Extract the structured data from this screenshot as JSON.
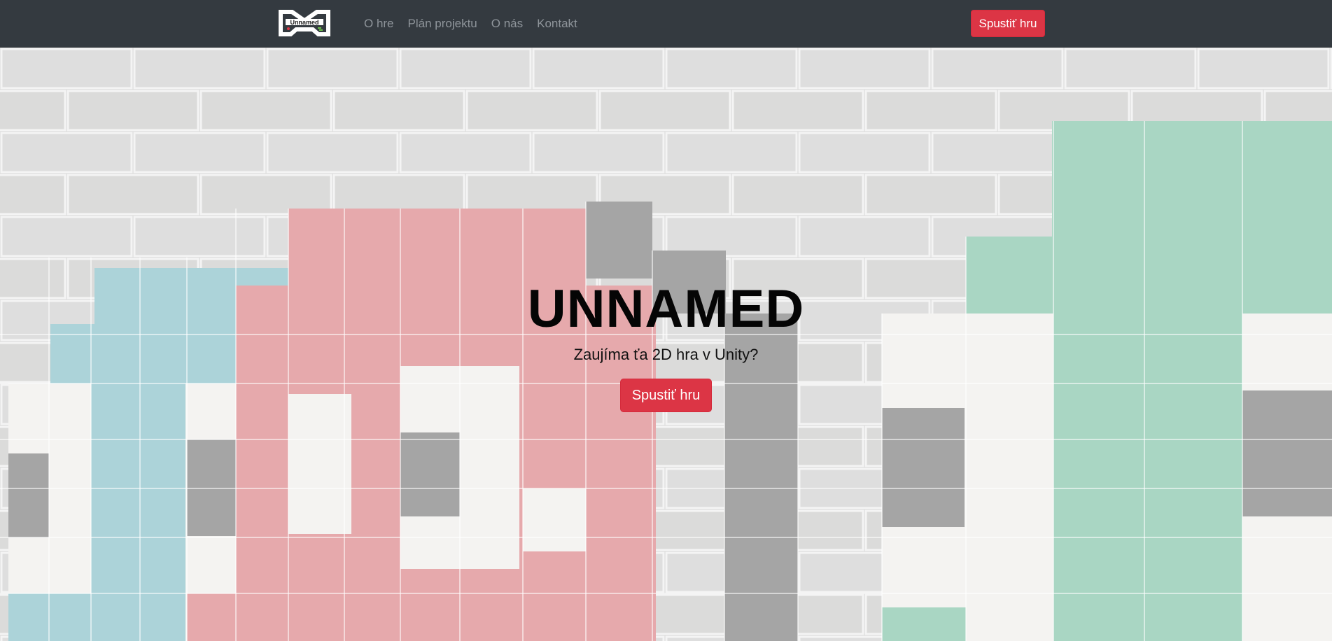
{
  "navbar": {
    "logo_text": "Unnamed",
    "links": [
      {
        "label": "O hre"
      },
      {
        "label": "Plán projektu"
      },
      {
        "label": "O nás"
      },
      {
        "label": "Kontakt"
      }
    ],
    "cta_label": "Spustiť hru"
  },
  "hero": {
    "title": "UNNAMED",
    "subtitle": "Zaujíma ťa 2D hra v Unity?",
    "cta_label": "Spustiť hru"
  },
  "colors": {
    "navbar_bg": "#343a40",
    "accent_red": "#dc3545",
    "tile_pink": "#e6a9ac",
    "tile_blue": "#acd3d9",
    "tile_green": "#a9d6c3",
    "tile_gray": "#a7a7a7",
    "tile_white": "#f6f5f3",
    "wall": "#dcdcdc"
  }
}
